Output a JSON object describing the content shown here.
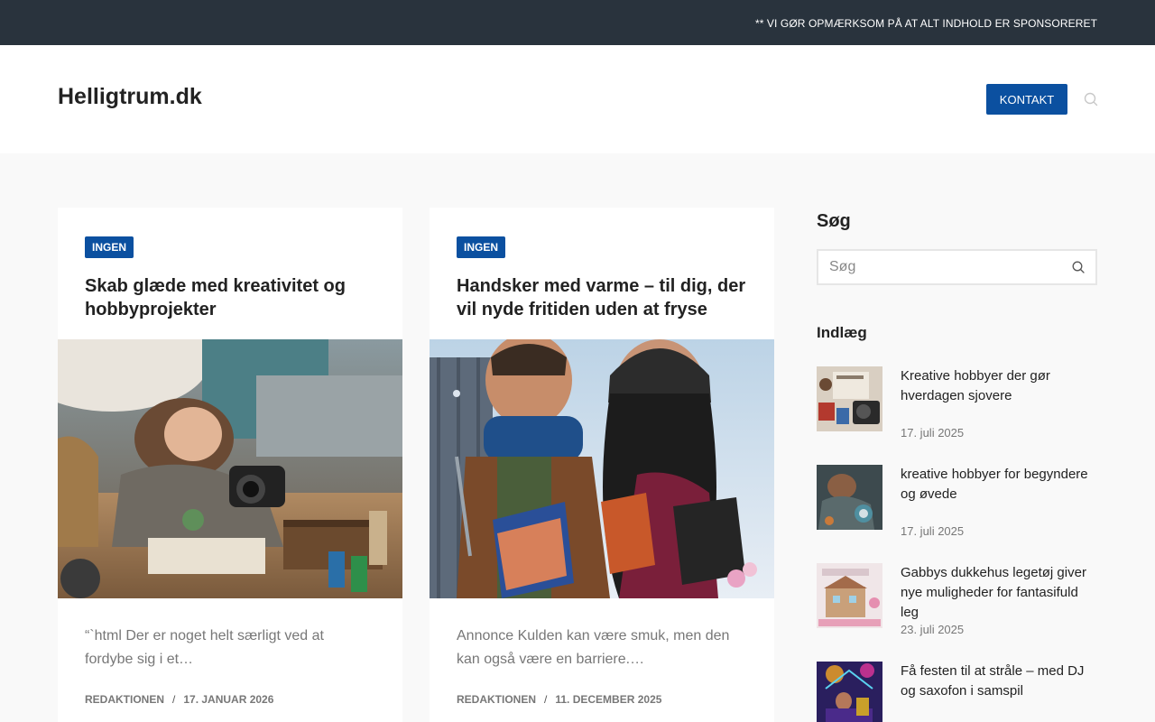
{
  "topbar": {
    "notice": "** VI GØR OPMÆRKSOM PÅ AT ALT INDHOLD ER SPONSORERET"
  },
  "header": {
    "site_title": "Helligtrum.dk",
    "contact_label": "KONTAKT"
  },
  "articles": [
    {
      "category": "INGEN",
      "title": "Skab glæde med kreativitet og hobbyprojekter",
      "excerpt": "“`html Der er noget helt særligt ved at fordybe sig i et…",
      "author": "REDAKTIONEN",
      "date": "17. JANUAR 2026"
    },
    {
      "category": "INGEN",
      "title": "Handsker med varme – til dig, der vil nyde fritiden uden at fryse",
      "excerpt": "Annonce Kulden kan være smuk, men den kan også være en barriere.…",
      "author": "REDAKTIONEN",
      "date": "11. DECEMBER 2025"
    }
  ],
  "sidebar": {
    "search_heading": "Søg",
    "search_placeholder": "Søg",
    "posts_heading": "Indlæg",
    "posts": [
      {
        "title": "Kreative hobbyer der gør hverdagen sjovere",
        "date": "17. juli 2025"
      },
      {
        "title": "kreative hobbyer for begyndere og øvede",
        "date": "17. juli 2025"
      },
      {
        "title": "Gabbys dukkehus legetøj giver nye muligheder for fantasifuld leg",
        "date": "23. juli 2025"
      },
      {
        "title": "Få festen til at stråle – med DJ og saxofon i samspil",
        "date": ""
      }
    ]
  },
  "colors": {
    "accent": "#0b50a0",
    "topbar_bg": "#29333d",
    "page_bg": "#f9f9f9"
  },
  "icons": {
    "header_search": "search-icon",
    "sidebar_search": "search-icon"
  }
}
